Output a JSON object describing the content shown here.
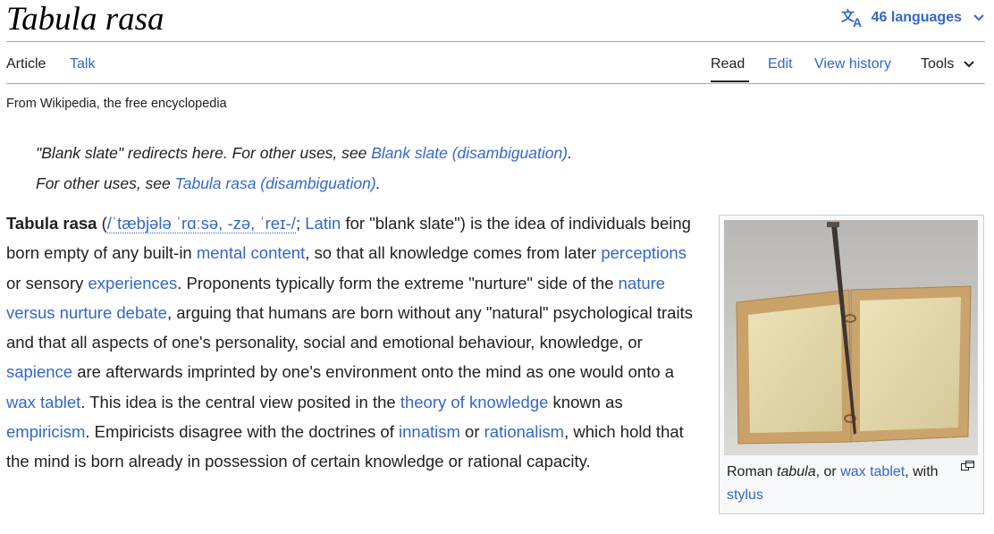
{
  "header": {
    "title": "Tabula rasa",
    "languages_label": "46 languages"
  },
  "tabs": {
    "article": "Article",
    "talk": "Talk",
    "read": "Read",
    "edit": "Edit",
    "view_history": "View history",
    "tools": "Tools"
  },
  "tagline": "From Wikipedia, the free encyclopedia",
  "hatnotes": {
    "line1_prefix": "\"Blank slate\" redirects here. For other uses, see ",
    "line1_link": "Blank slate (disambiguation)",
    "line1_suffix": ".",
    "line2_prefix": "For other uses, see ",
    "line2_link": "Tabula rasa (disambiguation)",
    "line2_suffix": "."
  },
  "body": {
    "bold_term": "Tabula rasa",
    "t1": " (",
    "ipa": "/ˈtæbjələ ˈrɑːsə, -zə, ˈreɪ-/",
    "t2": "; ",
    "latin": "Latin",
    "t3": " for \"blank slate\") is the idea of individuals being born empty of any built-in ",
    "mental_content": "mental content",
    "t4": ", so that all knowledge comes from later ",
    "perceptions": "perceptions",
    "t5": " or sensory ",
    "experiences": "experiences",
    "t6": ". Proponents typically form the extreme \"nurture\" side of the ",
    "nature_nurture": "nature versus nurture debate",
    "t7": ", arguing that humans are born without any \"natural\" psychological traits and that all aspects of one's personality, social and emotional behaviour, knowledge, or ",
    "sapience": "sapience",
    "t8": " are afterwards imprinted by one's environment onto the mind as one would onto a ",
    "wax_tablet": "wax tablet",
    "t9": ". This idea is the central view posited in the ",
    "theory_knowledge": "theory of knowledge",
    "t10": " known as ",
    "empiricism": "empiricism",
    "t11": ". Empiricists disagree with the doctrines of ",
    "innatism": "innatism",
    "t12": " or ",
    "rationalism": "rationalism",
    "t13": ", which hold that the mind is born already in possession of certain knowledge or rational capacity."
  },
  "figure": {
    "cap1": "Roman ",
    "cap_italic": "tabula",
    "cap2": ", or ",
    "cap_link1": "wax tablet",
    "cap3": ", with ",
    "cap_link2": "stylus"
  },
  "colors": {
    "link": "#3366cc",
    "text": "#202122",
    "border": "#a2a9b1"
  }
}
